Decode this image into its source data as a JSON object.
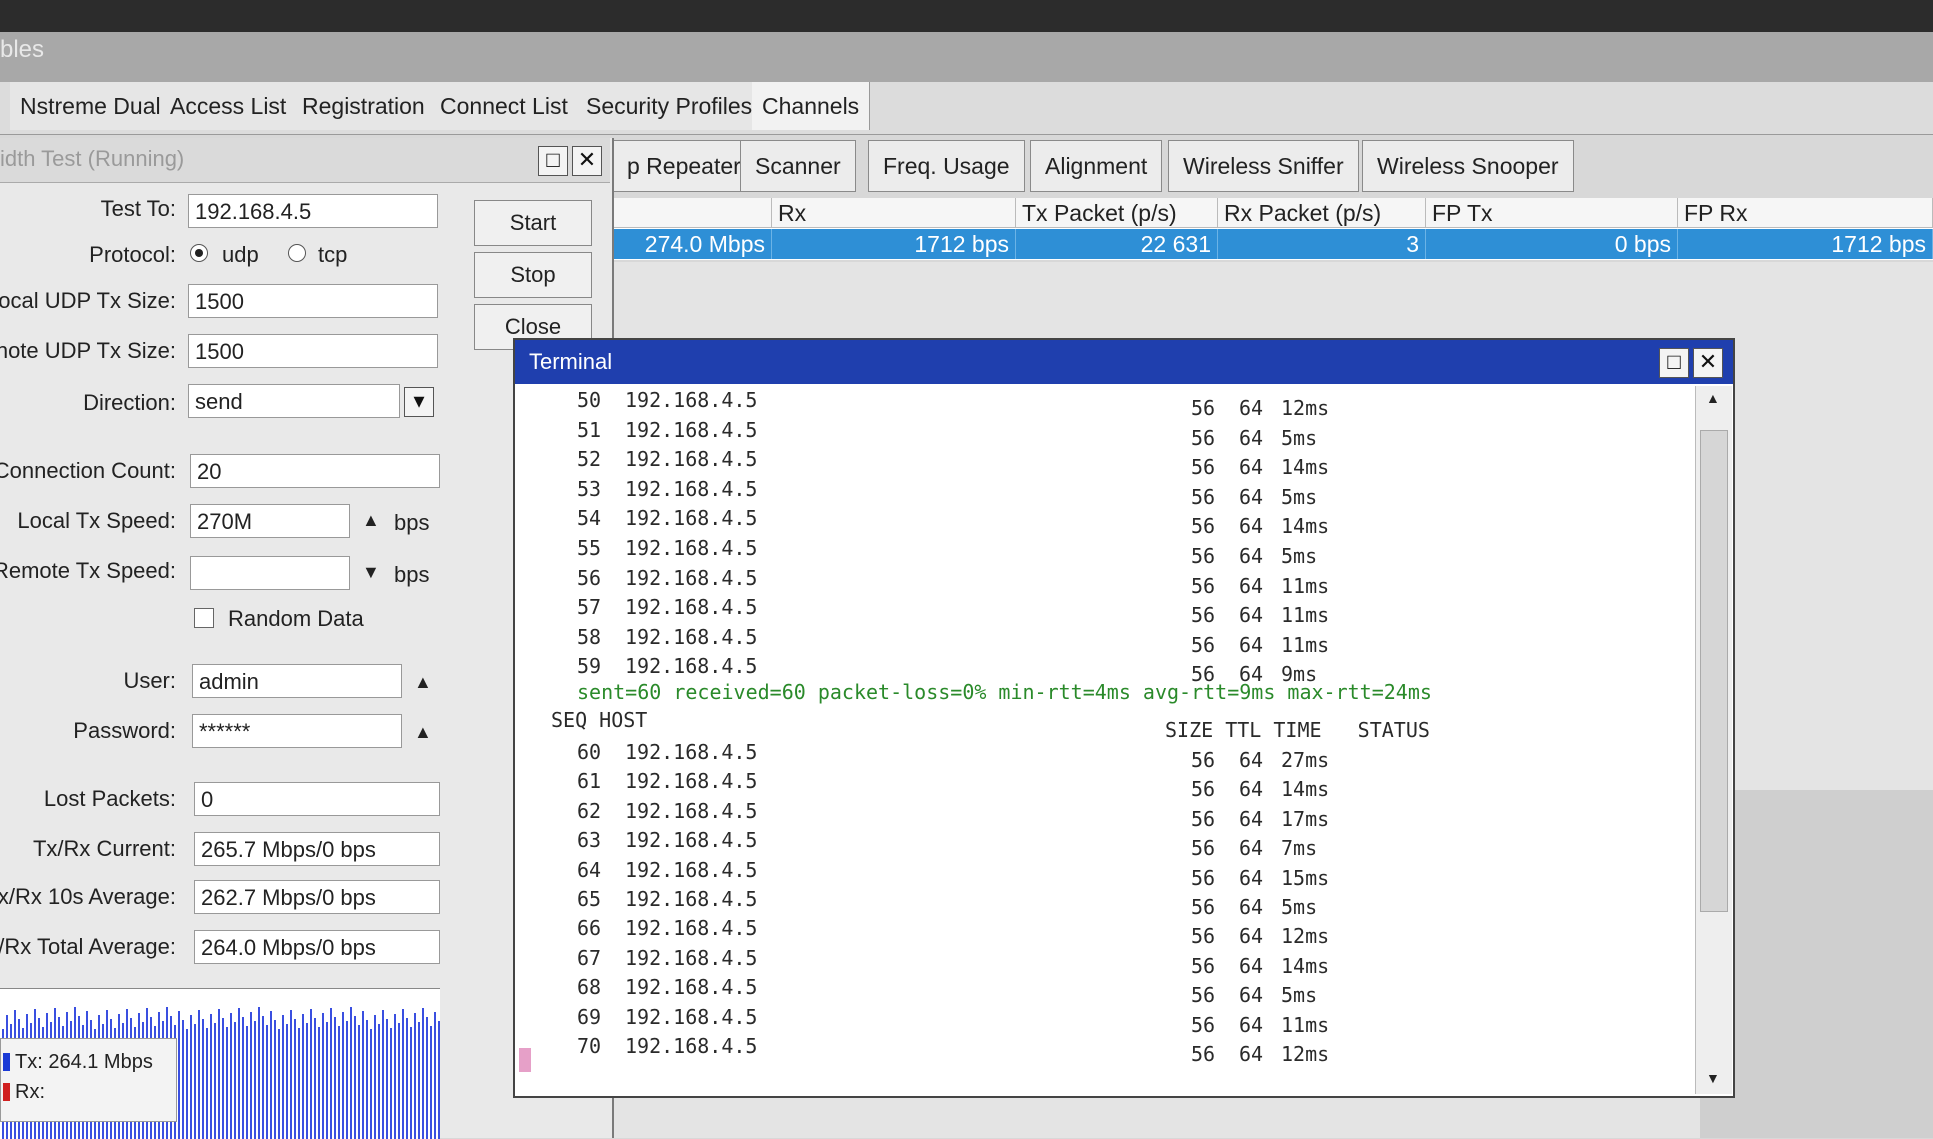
{
  "window_title_fragment": "bles",
  "tabs": [
    "Nstreme Dual",
    "Access List",
    "Registration",
    "Connect List",
    "Security Profiles",
    "Channels"
  ],
  "toolbar": [
    "p Repeater",
    "Scanner",
    "Freq. Usage",
    "Alignment",
    "Wireless Sniffer",
    "Wireless Snooper"
  ],
  "table": {
    "headers": [
      "Rx",
      "Tx Packet (p/s)",
      "Rx Packet (p/s)",
      "FP Tx",
      "FP Rx"
    ],
    "row": [
      "274.0 Mbps",
      "1712 bps",
      "22 631",
      "3",
      "0 bps",
      "1712 bps"
    ]
  },
  "bw": {
    "title": "idth Test (Running)",
    "labels": {
      "test_to": "Test To:",
      "protocol": "Protocol:",
      "local_udp": "ocal UDP Tx Size:",
      "remote_udp": "note UDP Tx Size:",
      "direction": "Direction:",
      "conn_count": "Connection Count:",
      "local_speed": "Local Tx Speed:",
      "remote_speed": "Remote Tx Speed:",
      "random": "Random Data",
      "user": "User:",
      "password": "Password:",
      "lost": "Lost Packets:",
      "current": "Tx/Rx Current:",
      "avg10": "x/Rx 10s Average:",
      "total": ":/Rx Total Average:"
    },
    "values": {
      "test_to": "192.168.4.5",
      "udp": "udp",
      "tcp": "tcp",
      "local_udp": "1500",
      "remote_udp": "1500",
      "direction": "send",
      "conn_count": "20",
      "local_speed": "270M",
      "remote_speed": "",
      "bps": "bps",
      "user": "admin",
      "password": "******",
      "lost": "0",
      "current": "265.7 Mbps/0 bps",
      "avg10": "262.7 Mbps/0 bps",
      "total": "264.0 Mbps/0 bps"
    },
    "buttons": {
      "start": "Start",
      "stop": "Stop",
      "close": "Close"
    },
    "legend": {
      "tx": "Tx:  264.1 Mbps",
      "rx": "Rx:"
    }
  },
  "terminal": {
    "title": "Terminal",
    "lines_a": [
      {
        "seq": "50",
        "host": "192.168.4.5",
        "size": "56",
        "ttl": "64",
        "time": "12ms"
      },
      {
        "seq": "51",
        "host": "192.168.4.5",
        "size": "56",
        "ttl": "64",
        "time": "5ms"
      },
      {
        "seq": "52",
        "host": "192.168.4.5",
        "size": "56",
        "ttl": "64",
        "time": "14ms"
      },
      {
        "seq": "53",
        "host": "192.168.4.5",
        "size": "56",
        "ttl": "64",
        "time": "5ms"
      },
      {
        "seq": "54",
        "host": "192.168.4.5",
        "size": "56",
        "ttl": "64",
        "time": "14ms"
      },
      {
        "seq": "55",
        "host": "192.168.4.5",
        "size": "56",
        "ttl": "64",
        "time": "5ms"
      },
      {
        "seq": "56",
        "host": "192.168.4.5",
        "size": "56",
        "ttl": "64",
        "time": "11ms"
      },
      {
        "seq": "57",
        "host": "192.168.4.5",
        "size": "56",
        "ttl": "64",
        "time": "11ms"
      },
      {
        "seq": "58",
        "host": "192.168.4.5",
        "size": "56",
        "ttl": "64",
        "time": "11ms"
      },
      {
        "seq": "59",
        "host": "192.168.4.5",
        "size": "56",
        "ttl": "64",
        "time": "9ms"
      }
    ],
    "stats": "sent=60 received=60 packet-loss=0% min-rtt=4ms avg-rtt=9ms max-rtt=24ms",
    "header_left": "SEQ HOST",
    "header_right": "SIZE TTL TIME   STATUS",
    "lines_b": [
      {
        "seq": "60",
        "host": "192.168.4.5",
        "size": "56",
        "ttl": "64",
        "time": "27ms"
      },
      {
        "seq": "61",
        "host": "192.168.4.5",
        "size": "56",
        "ttl": "64",
        "time": "14ms"
      },
      {
        "seq": "62",
        "host": "192.168.4.5",
        "size": "56",
        "ttl": "64",
        "time": "17ms"
      },
      {
        "seq": "63",
        "host": "192.168.4.5",
        "size": "56",
        "ttl": "64",
        "time": "7ms"
      },
      {
        "seq": "64",
        "host": "192.168.4.5",
        "size": "56",
        "ttl": "64",
        "time": "15ms"
      },
      {
        "seq": "65",
        "host": "192.168.4.5",
        "size": "56",
        "ttl": "64",
        "time": "5ms"
      },
      {
        "seq": "66",
        "host": "192.168.4.5",
        "size": "56",
        "ttl": "64",
        "time": "12ms"
      },
      {
        "seq": "67",
        "host": "192.168.4.5",
        "size": "56",
        "ttl": "64",
        "time": "14ms"
      },
      {
        "seq": "68",
        "host": "192.168.4.5",
        "size": "56",
        "ttl": "64",
        "time": "5ms"
      },
      {
        "seq": "69",
        "host": "192.168.4.5",
        "size": "56",
        "ttl": "64",
        "time": "11ms"
      },
      {
        "seq": "70",
        "host": "192.168.4.5",
        "size": "56",
        "ttl": "64",
        "time": "12ms"
      }
    ]
  },
  "colors": {
    "terminal_title": "#1f3fae",
    "selected_row": "#2e8fd6",
    "stats_text": "#2a8a2a",
    "tx_legend": "#1a3ad6",
    "rx_legend": "#d02020"
  }
}
